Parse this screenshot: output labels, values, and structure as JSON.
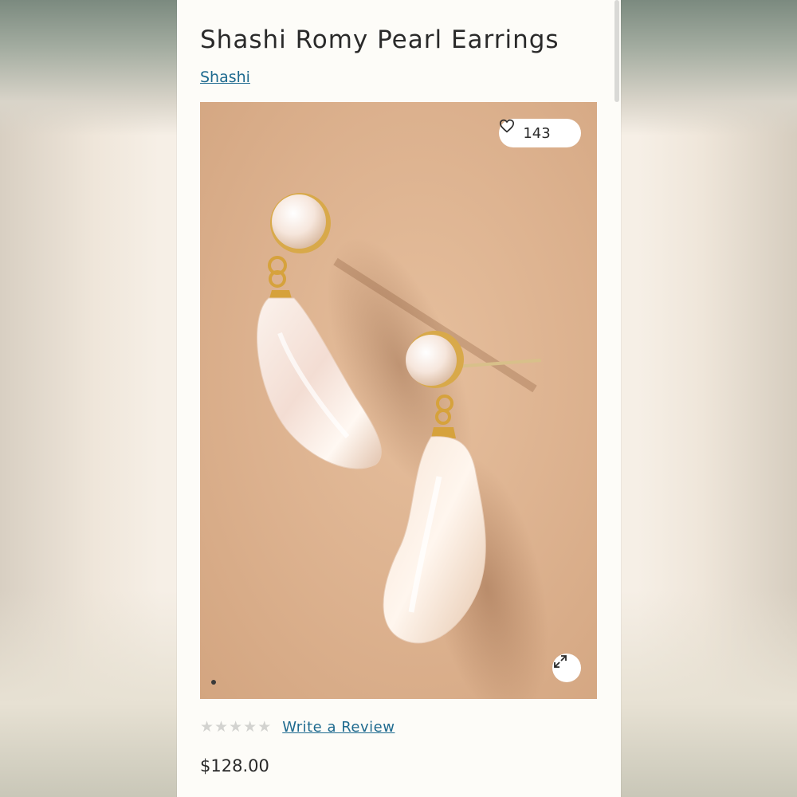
{
  "product": {
    "title": "Shashi Romy Pearl Earrings",
    "brand": "Shashi",
    "price": "$128.00"
  },
  "image": {
    "favorites_count": "143",
    "favorite_icon": "heart-icon",
    "expand_icon": "expand-arrows-icon",
    "carousel_active_index": 1
  },
  "rating": {
    "stars_filled": 0,
    "stars_total": 5,
    "write_review_label": "Write a Review"
  },
  "colors": {
    "link": "#1e6a8f",
    "star_empty": "#d3d3d0",
    "image_background": "#dcb18e",
    "panel_background": "#fdfcf8"
  }
}
